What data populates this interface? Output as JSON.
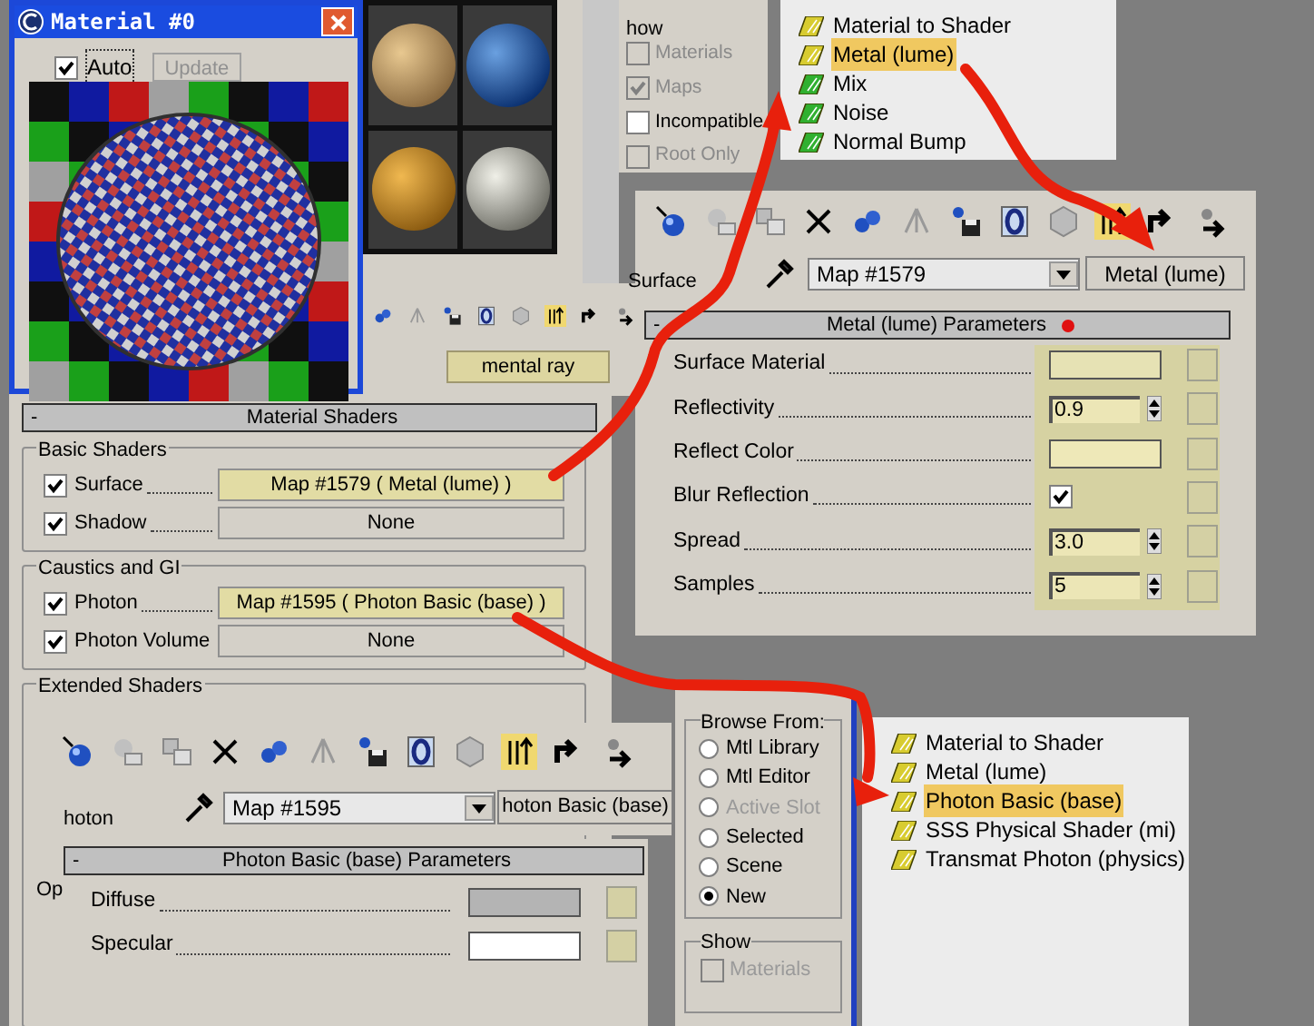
{
  "material_window": {
    "title": "Material #0",
    "auto": {
      "label": "Auto",
      "checked": true
    },
    "update_button": {
      "label": "Update",
      "disabled": true
    }
  },
  "editor_strip": {
    "renderer_button": "mental ray"
  },
  "show_group_top": {
    "title": "how",
    "options": [
      {
        "label": "Materials",
        "checked": false,
        "disabled": true
      },
      {
        "label": "Maps",
        "checked": true,
        "disabled": true
      },
      {
        "label": "Incompatible",
        "checked": false,
        "disabled": false
      },
      {
        "label": "Root Only",
        "checked": false,
        "disabled": true
      }
    ]
  },
  "browser_list_top": {
    "items": [
      {
        "label": "Material to Shader",
        "kind": "material",
        "selected": false
      },
      {
        "label": "Metal (lume)",
        "kind": "material",
        "selected": true
      },
      {
        "label": "Mix",
        "kind": "map",
        "selected": false
      },
      {
        "label": "Noise",
        "kind": "map",
        "selected": false
      },
      {
        "label": "Normal Bump",
        "kind": "map",
        "selected": false
      }
    ]
  },
  "metal_panel": {
    "collapse_symbol": "-",
    "slot_label": "Surface",
    "map_name": "Map #1579",
    "type_button": "Metal (lume)",
    "rollout_title": "Metal (lume) Parameters",
    "params": [
      {
        "label": "Surface Material",
        "kind": "color",
        "color": "#e6e2b4"
      },
      {
        "label": "Reflectivity",
        "kind": "spinner",
        "value": "0.9"
      },
      {
        "label": "Reflect Color",
        "kind": "color",
        "color": "#eee8b8"
      },
      {
        "label": "Blur Reflection",
        "kind": "checkbox",
        "checked": true
      },
      {
        "label": "Spread",
        "kind": "spinner",
        "value": "3.0"
      },
      {
        "label": "Samples",
        "kind": "spinner",
        "value": "5"
      }
    ]
  },
  "material_shaders": {
    "collapse_symbol": "-",
    "title": "Material Shaders",
    "groups": [
      {
        "title": "Basic Shaders",
        "rows": [
          {
            "label": "Surface",
            "checked": true,
            "value": "Map #1579  ( Metal (lume) )",
            "highlighted": true
          },
          {
            "label": "Shadow",
            "checked": true,
            "value": "None",
            "highlighted": false
          }
        ]
      },
      {
        "title": "Caustics and GI",
        "rows": [
          {
            "label": "Photon",
            "checked": true,
            "value": "Map #1595  ( Photon Basic (base) )",
            "highlighted": true
          },
          {
            "label": "Photon Volume",
            "checked": true,
            "value": "None",
            "highlighted": false
          }
        ]
      },
      {
        "title": "Extended Shaders"
      }
    ],
    "partial_group_title": "Op"
  },
  "photon_panel": {
    "collapse_symbol": "-",
    "slot_label": "hoton",
    "map_name": "Map #1595",
    "type_button": "hoton Basic (base)",
    "rollout_title": "Photon Basic (base) Parameters",
    "params": [
      {
        "label": "Diffuse",
        "kind": "color",
        "color": "#b4b4b4"
      },
      {
        "label": "Specular",
        "kind": "color",
        "color": "#ffffff"
      }
    ]
  },
  "browse_from": {
    "title": "Browse From:",
    "options": [
      {
        "label": "Mtl Library",
        "selected": false,
        "disabled": false
      },
      {
        "label": "Mtl Editor",
        "selected": false,
        "disabled": false
      },
      {
        "label": "Active Slot",
        "selected": false,
        "disabled": true
      },
      {
        "label": "Selected",
        "selected": false,
        "disabled": false
      },
      {
        "label": "Scene",
        "selected": false,
        "disabled": false
      },
      {
        "label": "New",
        "selected": true,
        "disabled": false
      }
    ],
    "show": {
      "title": "Show",
      "options": [
        {
          "label": "Materials",
          "checked": false,
          "disabled": true
        }
      ]
    }
  },
  "browser_list_bottom": {
    "items": [
      {
        "label": "Material to Shader",
        "kind": "material",
        "selected": false
      },
      {
        "label": "Metal (lume)",
        "kind": "material",
        "selected": false
      },
      {
        "label": "Photon Basic (base)",
        "kind": "material",
        "selected": true
      },
      {
        "label": "SSS Physical Shader (mi)",
        "kind": "material",
        "selected": false
      },
      {
        "label": "Transmat Photon (physics)",
        "kind": "material",
        "selected": false
      }
    ]
  }
}
